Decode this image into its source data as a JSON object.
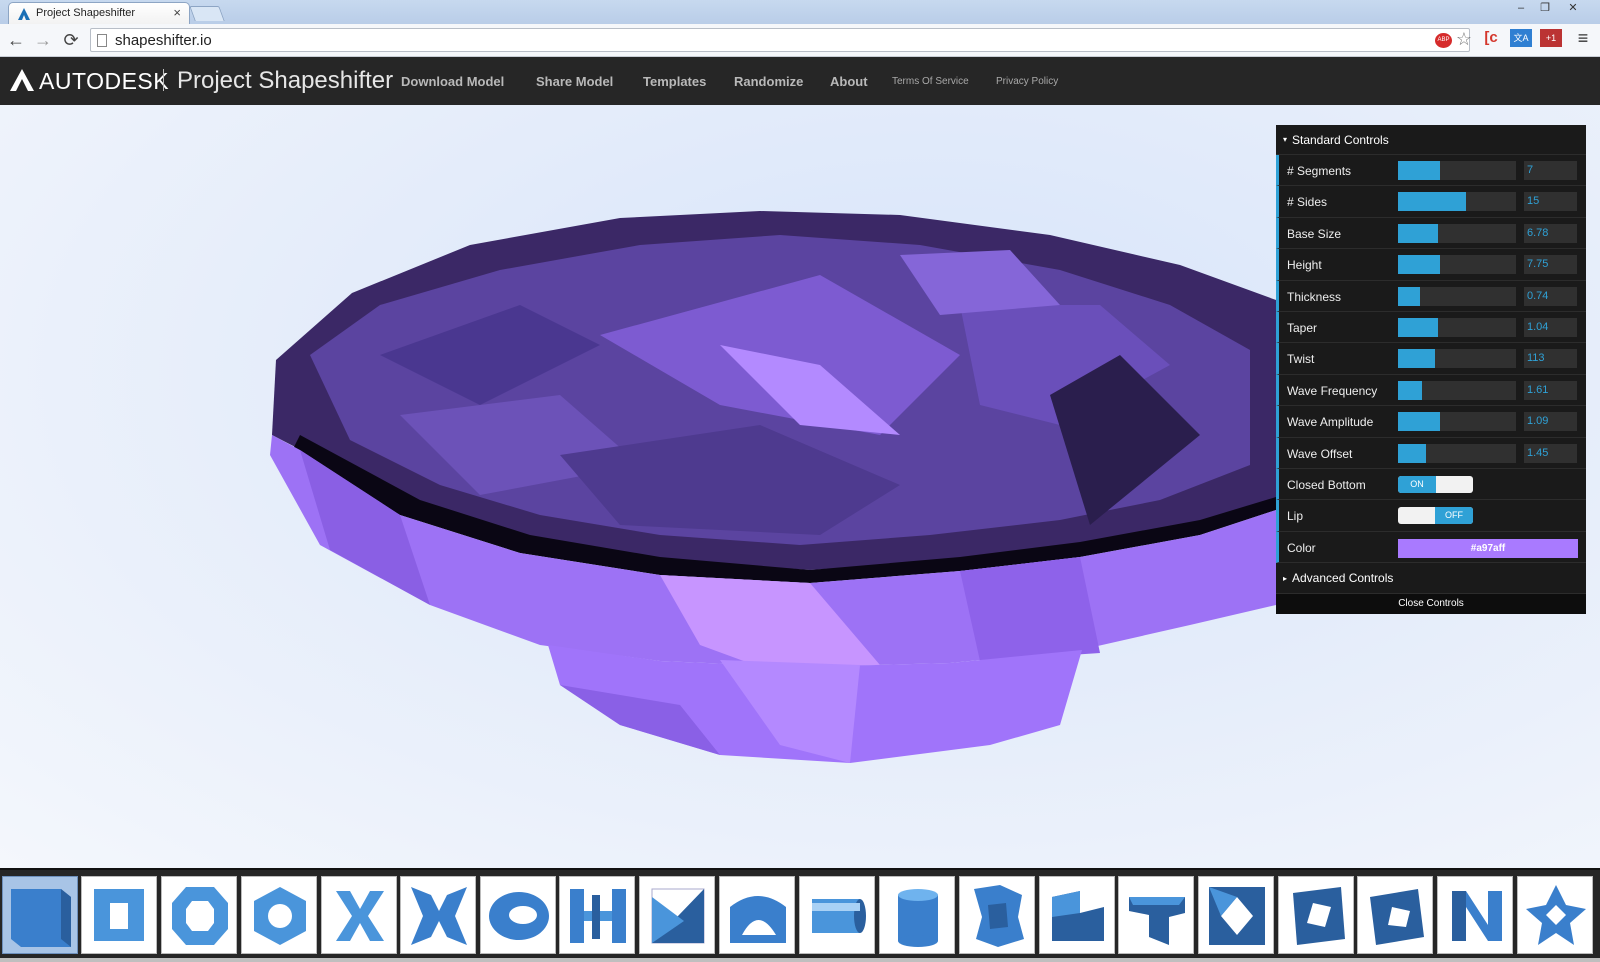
{
  "browser": {
    "tab_title": "Project Shapeshifter",
    "tab_close": "×",
    "window_buttons": [
      "–",
      "❐",
      "✕"
    ],
    "url": "shapeshifter.io",
    "back": "←",
    "forward": "→",
    "reload": "⟳",
    "menu": "≡",
    "extensions": [
      "ABP",
      "☆",
      "[c",
      "文A",
      "+1"
    ]
  },
  "header": {
    "brand": "AUTODESK",
    "product": "Project Shapeshifter",
    "nav": [
      "Download Model",
      "Share Model",
      "Templates",
      "Randomize",
      "About"
    ],
    "nav_small": [
      "Terms Of Service",
      "Privacy Policy"
    ]
  },
  "controls": {
    "standard_title": "Standard Controls",
    "sliders": [
      {
        "label": "# Segments",
        "value": "7",
        "fill": 0.36
      },
      {
        "label": "# Sides",
        "value": "15",
        "fill": 0.58
      },
      {
        "label": "Base Size",
        "value": "6.78",
        "fill": 0.34
      },
      {
        "label": "Height",
        "value": "7.75",
        "fill": 0.36
      },
      {
        "label": "Thickness",
        "value": "0.74",
        "fill": 0.19
      },
      {
        "label": "Taper",
        "value": "1.04",
        "fill": 0.34
      },
      {
        "label": "Twist",
        "value": "113",
        "fill": 0.31
      },
      {
        "label": "Wave Frequency",
        "value": "1.61",
        "fill": 0.2
      },
      {
        "label": "Wave Amplitude",
        "value": "1.09",
        "fill": 0.36
      },
      {
        "label": "Wave Offset",
        "value": "1.45",
        "fill": 0.24
      }
    ],
    "closed_bottom": {
      "label": "Closed Bottom",
      "state": "ON"
    },
    "lip": {
      "label": "Lip",
      "state": "OFF"
    },
    "color": {
      "label": "Color",
      "value": "#a97aff"
    },
    "advanced_title": "Advanced Controls",
    "close_label": "Close Controls"
  },
  "templates": {
    "count": 20,
    "selected_index": 0
  },
  "colors": {
    "accent": "#2fa1d6",
    "model": "#a97aff",
    "header_bg": "#262626",
    "panel_bg": "#1a1a1a",
    "template_blue": "#3f8fd6"
  }
}
